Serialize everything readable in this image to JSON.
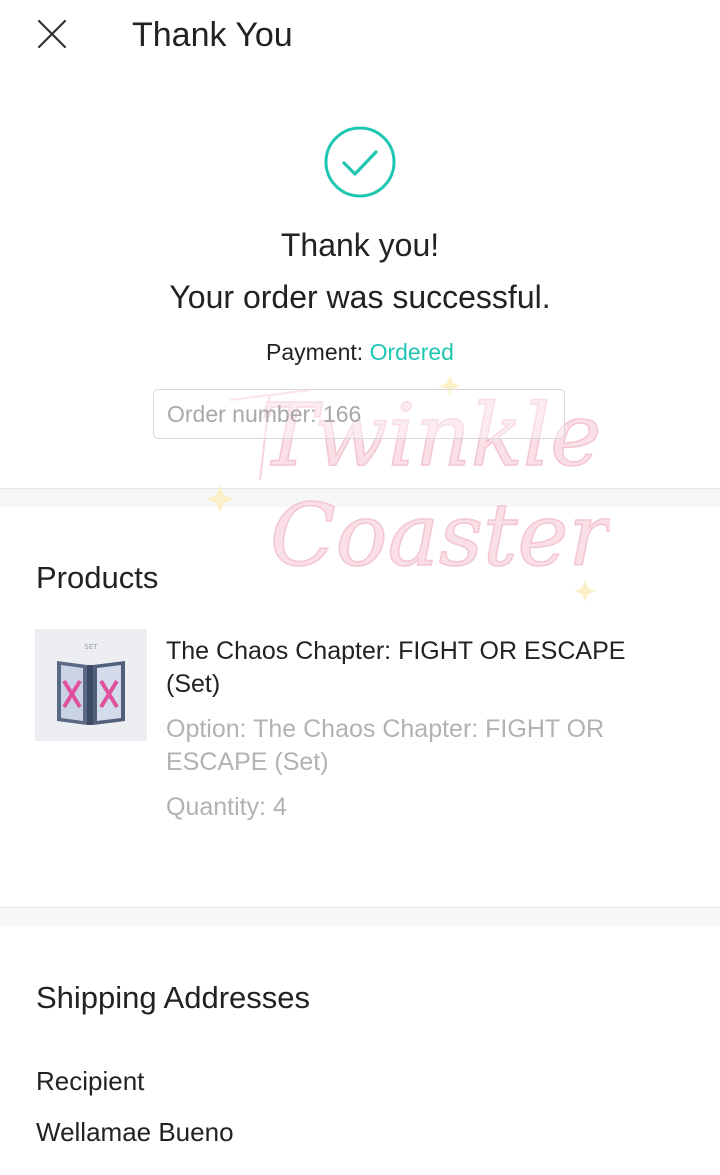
{
  "header": {
    "title": "Thank You",
    "close_icon": "close-icon"
  },
  "success": {
    "icon": "check-circle-icon",
    "accent_color": "#1fc7b3",
    "line1": "Thank you!",
    "line2": "Your order was successful."
  },
  "payment": {
    "label": "Payment:",
    "status": "Ordered"
  },
  "order": {
    "number_text": "Order number: 166"
  },
  "products": {
    "section_title": "Products",
    "items": [
      {
        "thumb_label": "SET",
        "name": "The Chaos Chapter: FIGHT OR ESCAPE (Set)",
        "option": "Option: The Chaos Chapter: FIGHT OR ESCAPE (Set)",
        "quantity": "Quantity: 4"
      }
    ]
  },
  "shipping": {
    "section_title": "Shipping Addresses",
    "recipient_label": "Recipient",
    "recipient_name": "Wellamae Bueno"
  },
  "watermark": {
    "line1": "Twinkle",
    "line2": "Coaster"
  }
}
